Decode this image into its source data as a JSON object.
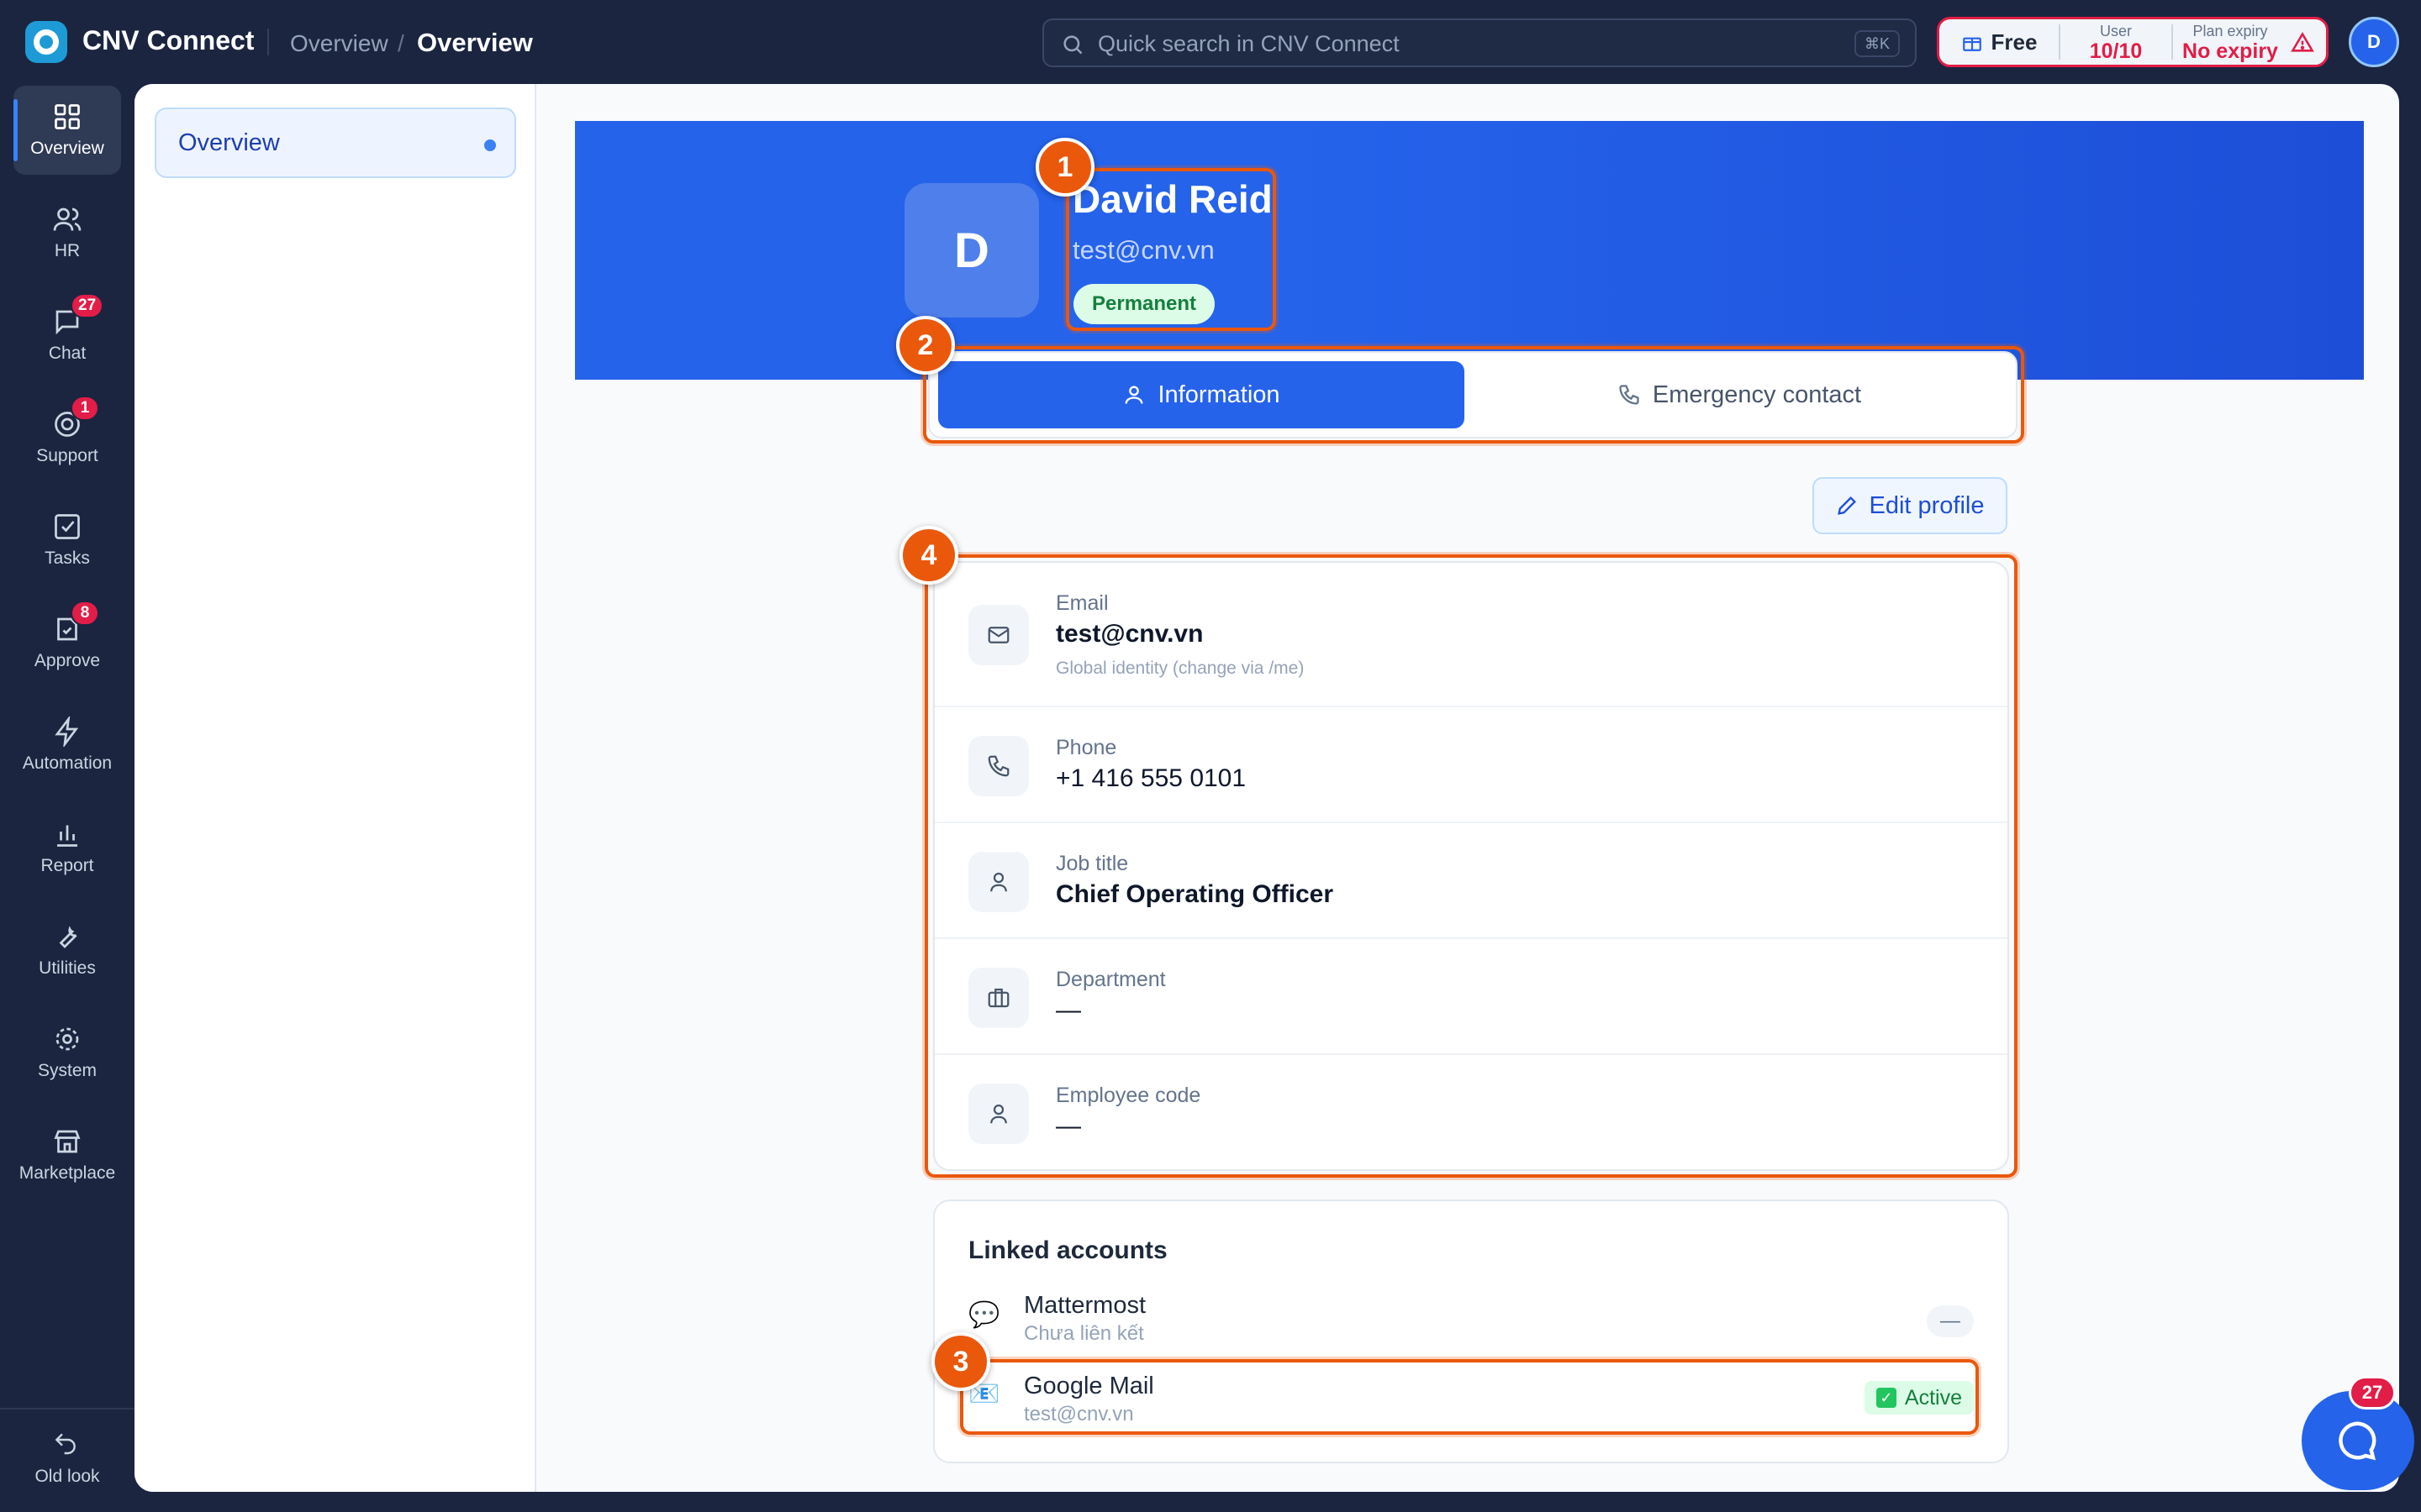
{
  "app": {
    "title": "CNV Connect"
  },
  "breadcrumb": {
    "parent": "Overview",
    "separator": "/",
    "current": "Overview"
  },
  "search": {
    "placeholder": "Quick search in CNV Connect",
    "shortcut": "⌘K"
  },
  "plan": {
    "name": "Free",
    "user_label": "User",
    "user_value": "10/10",
    "expiry_label": "Plan expiry",
    "expiry_value": "No expiry",
    "accent": "#e11d48"
  },
  "user_avatar": "D",
  "rail": {
    "items": [
      {
        "label": "Overview",
        "icon": "grid-icon",
        "active": true
      },
      {
        "label": "HR",
        "icon": "users-icon"
      },
      {
        "label": "Chat",
        "icon": "chat-icon",
        "badge": "27"
      },
      {
        "label": "Support",
        "icon": "support-icon",
        "badge": "1"
      },
      {
        "label": "Tasks",
        "icon": "checkbox-icon"
      },
      {
        "label": "Approve",
        "icon": "approve-icon",
        "badge": "8"
      },
      {
        "label": "Automation",
        "icon": "bolt-icon"
      },
      {
        "label": "Report",
        "icon": "bar-chart-icon"
      },
      {
        "label": "Utilities",
        "icon": "wrench-icon"
      },
      {
        "label": "System",
        "icon": "gear-icon"
      },
      {
        "label": "Marketplace",
        "icon": "store-icon"
      }
    ],
    "old_look": "Old look"
  },
  "subnav": {
    "items": [
      {
        "label": "Overview",
        "active": true
      }
    ]
  },
  "profile": {
    "initial": "D",
    "name": "David Reid",
    "email": "test@cnv.vn",
    "status": "Permanent"
  },
  "tabs": {
    "information": "Information",
    "emergency": "Emergency contact"
  },
  "edit_profile": "Edit profile",
  "info": {
    "email": {
      "label": "Email",
      "value": "test@cnv.vn",
      "hint": "Global identity (change via /me)"
    },
    "phone": {
      "label": "Phone",
      "value": "+1 416 555 0101"
    },
    "job_title": {
      "label": "Job title",
      "value": "Chief Operating Officer"
    },
    "department": {
      "label": "Department",
      "value": "—"
    },
    "employee_code": {
      "label": "Employee code",
      "value": "—"
    }
  },
  "linked": {
    "title": "Linked accounts",
    "accounts": [
      {
        "name": "Mattermost",
        "sub": "Chưa liên kết",
        "status": "—"
      },
      {
        "name": "Google Mail",
        "sub": "test@cnv.vn",
        "status": "Active"
      }
    ]
  },
  "markers": [
    "1",
    "2",
    "3",
    "4"
  ],
  "chat_fab_badge": "27",
  "colors": {
    "primary": "#2563eb",
    "highlight": "#ea580c",
    "sidebar": "#1b2540"
  }
}
